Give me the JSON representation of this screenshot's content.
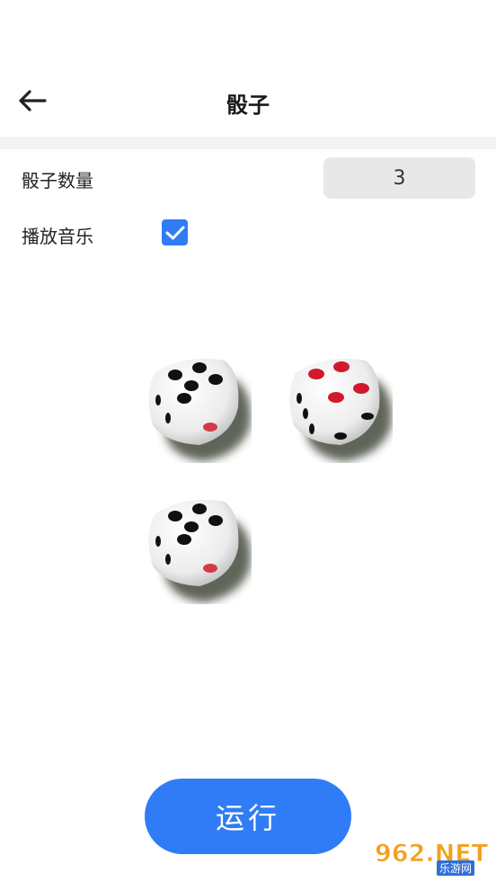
{
  "header": {
    "title": "骰子"
  },
  "settings": {
    "dice_count_label": "骰子数量",
    "dice_count_value": "3",
    "music_label": "播放音乐",
    "music_enabled": true
  },
  "dice": [
    {
      "face": 5,
      "pip_color": "#111111",
      "side_pips": 2,
      "side_accent": "#d23a4a"
    },
    {
      "face": 4,
      "pip_color": "#d0192c",
      "side_pips": 3,
      "side_accent": "#111111"
    },
    {
      "face": 5,
      "pip_color": "#111111",
      "side_pips": 2,
      "side_accent": "#d23a4a"
    }
  ],
  "actions": {
    "run_label": "运行"
  },
  "watermark": {
    "text": "962.NET",
    "sub": "乐游网"
  },
  "colors": {
    "accent": "#2f7cf6"
  }
}
